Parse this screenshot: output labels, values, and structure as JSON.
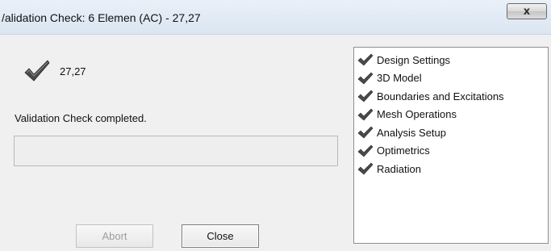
{
  "window": {
    "title": "/alidation Check: 6 Elemen (AC) - 27,27",
    "close_glyph": "x"
  },
  "summary": {
    "icon": "checkmark-icon",
    "value": "27,27",
    "status": "Validation Check completed.",
    "progress_percent": 0
  },
  "buttons": {
    "abort_label": "Abort",
    "abort_enabled": false,
    "close_label": "Close"
  },
  "checks": {
    "items": [
      {
        "label": "Design Settings",
        "icon": "checkmark-icon"
      },
      {
        "label": "3D Model",
        "icon": "checkmark-icon"
      },
      {
        "label": "Boundaries and Excitations",
        "icon": "checkmark-icon"
      },
      {
        "label": "Mesh Operations",
        "icon": "checkmark-icon"
      },
      {
        "label": "Analysis Setup",
        "icon": "checkmark-icon"
      },
      {
        "label": "Optimetrics",
        "icon": "checkmark-icon"
      },
      {
        "label": "Radiation",
        "icon": "checkmark-icon"
      }
    ]
  },
  "colors": {
    "check": "#4a4a4a",
    "title_bar": "#dbe6f2"
  }
}
